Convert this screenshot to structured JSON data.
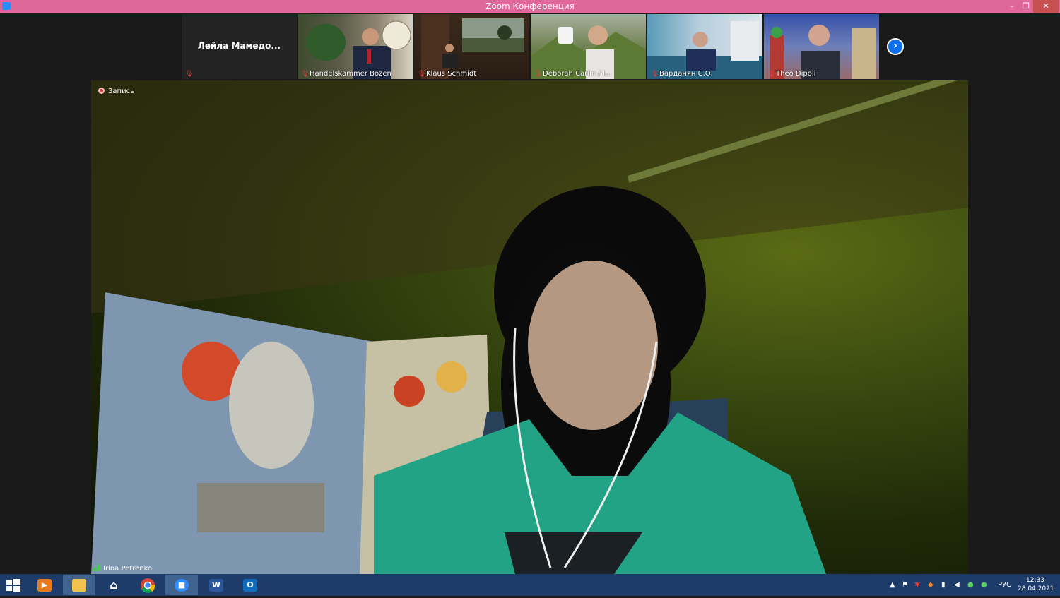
{
  "window": {
    "title": "Zoom Конференция",
    "controls": {
      "minimize": "–",
      "restore": "❐",
      "close": "✕"
    }
  },
  "gallery": {
    "name_only_tile": "Лейла  Мамедо...",
    "participants": [
      {
        "name": "Handelskammer Bozen"
      },
      {
        "name": "Klaus Schmidt"
      },
      {
        "name": "Deborah Carlin / I..."
      },
      {
        "name": "Варданян С.О."
      },
      {
        "name": "Theo Dipoli"
      }
    ],
    "next_icon": "›"
  },
  "main": {
    "recording_label": "Запись",
    "speaker_name": "Irina Petrenko"
  },
  "taskbar": {
    "word_glyph": "W",
    "outlook_glyph": "O",
    "language": "РУС",
    "time": "12:33",
    "date": "28.04.2021"
  }
}
